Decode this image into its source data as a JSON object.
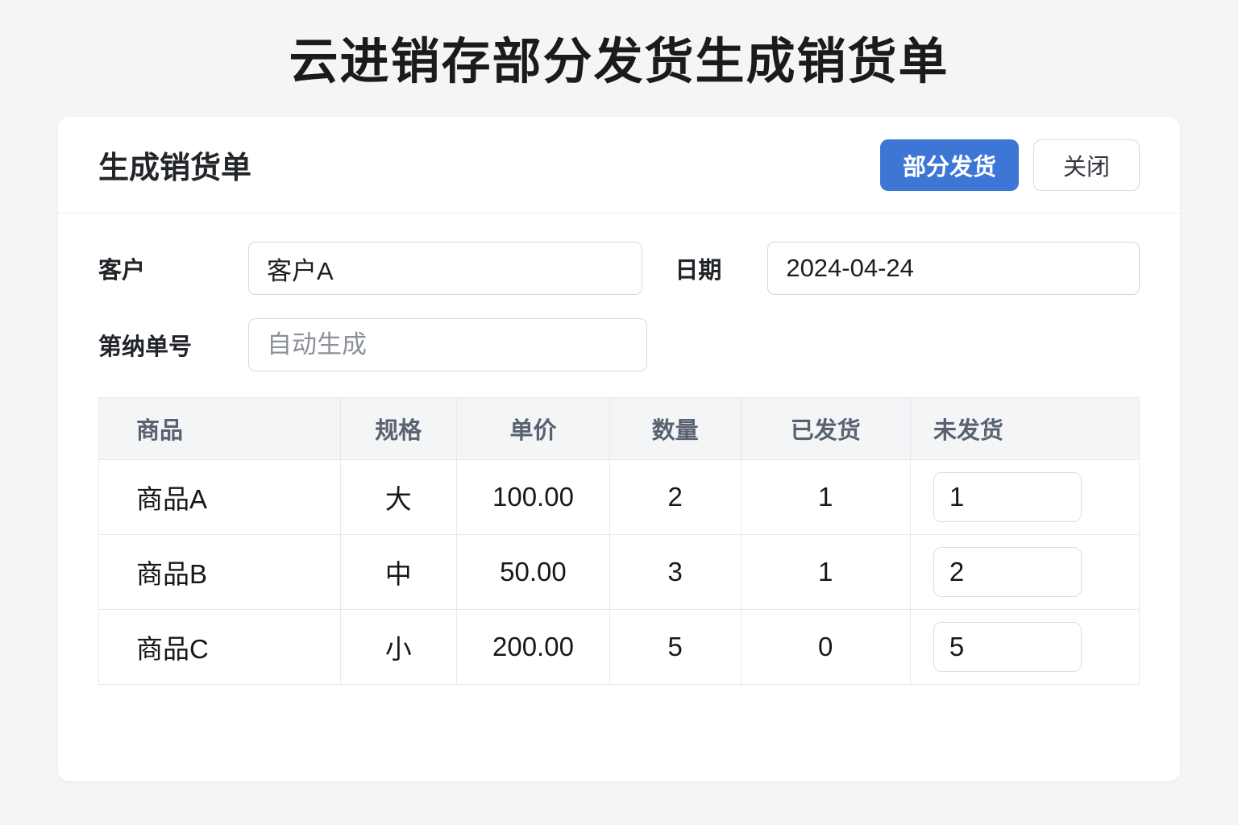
{
  "page": {
    "title": "云进销存部分发货生成销货单"
  },
  "panel": {
    "title": "生成销货单",
    "buttons": {
      "partial_ship_label": "部分发货",
      "close_label": "关闭"
    }
  },
  "form": {
    "customer": {
      "label": "客户",
      "value": "客户A"
    },
    "date": {
      "label": "日期",
      "value": "2024-04-24"
    },
    "order_no": {
      "label": "第纳单号",
      "placeholder": "自动生成"
    }
  },
  "table": {
    "headers": {
      "product": "商品",
      "spec": "规格",
      "price": "单价",
      "qty": "数量",
      "shipped": "已发货",
      "unshipped": "未发货"
    },
    "rows": [
      {
        "product": "商品A",
        "spec": "大",
        "price": "100.00",
        "qty": "2",
        "shipped": "1",
        "unshipped": "1"
      },
      {
        "product": "商品B",
        "spec": "中",
        "price": "50.00",
        "qty": "3",
        "shipped": "1",
        "unshipped": "2"
      },
      {
        "product": "商品C",
        "spec": "小",
        "price": "200.00",
        "qty": "5",
        "shipped": "0",
        "unshipped": "5"
      }
    ]
  },
  "colors": {
    "primary_button": "#3e76d6",
    "page_background": "#f5f5f6",
    "table_header_background": "#f4f5f7",
    "border": "#e6e8eb"
  }
}
